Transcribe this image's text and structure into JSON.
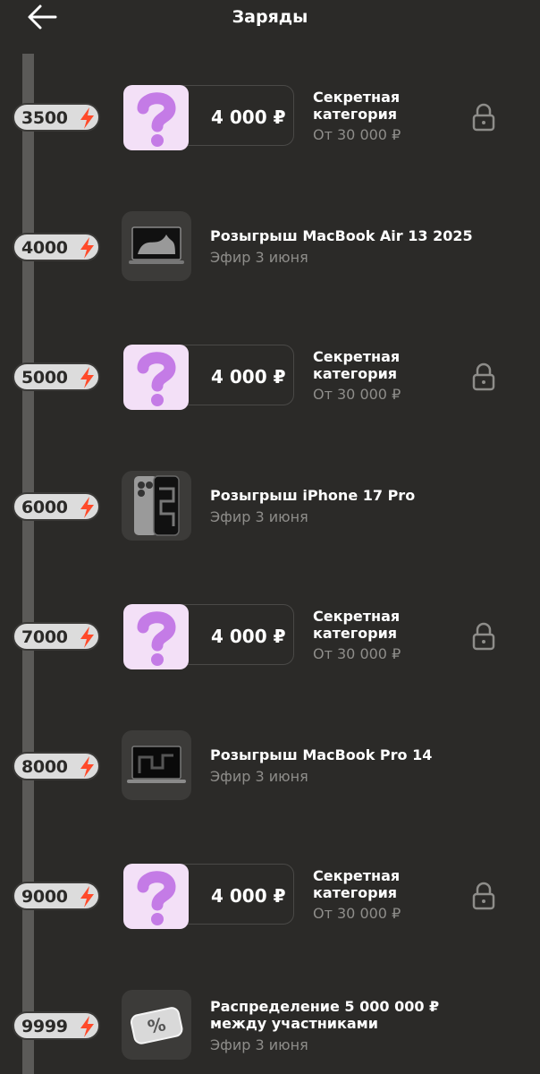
{
  "header": {
    "title": "Заряды",
    "back_icon": "arrow-left-icon"
  },
  "colors": {
    "background": "#2b2a28",
    "bolt": "#ff4a2a",
    "secret_bg": "#f3e0f7",
    "muted": "#8e8d8a"
  },
  "rows": [
    {
      "type": "secret",
      "charges": "3500",
      "price": "4 000 ₽",
      "title": "Секретная категория",
      "subtitle": "От 30 000 ₽",
      "locked": true
    },
    {
      "type": "prize",
      "charges": "4000",
      "title": "Розыгрыш MacBook Air 13 2025",
      "subtitle": "Эфир 3 июня",
      "image": "macbook-air-icon"
    },
    {
      "type": "secret",
      "charges": "5000",
      "price": "4 000 ₽",
      "title": "Секретная категория",
      "subtitle": "От 30 000 ₽",
      "locked": true
    },
    {
      "type": "prize",
      "charges": "6000",
      "title": "Розыгрыш iPhone 17 Pro",
      "subtitle": "Эфир 3 июня",
      "image": "iphone-icon"
    },
    {
      "type": "secret",
      "charges": "7000",
      "price": "4 000 ₽",
      "title": "Секретная категория",
      "subtitle": "От 30 000 ₽",
      "locked": true
    },
    {
      "type": "prize",
      "charges": "8000",
      "title": "Розыгрыш MacBook Pro 14",
      "subtitle": "Эфир 3 июня",
      "image": "macbook-pro-icon"
    },
    {
      "type": "secret",
      "charges": "9000",
      "price": "4 000 ₽",
      "title": "Секретная категория",
      "subtitle": "От 30 000 ₽",
      "locked": true
    },
    {
      "type": "prize",
      "charges": "9999",
      "title": "Распределение 5 000 000 ₽ между участниками",
      "subtitle": "Эфир 3 июня",
      "image": "discount-ticket-icon"
    }
  ]
}
